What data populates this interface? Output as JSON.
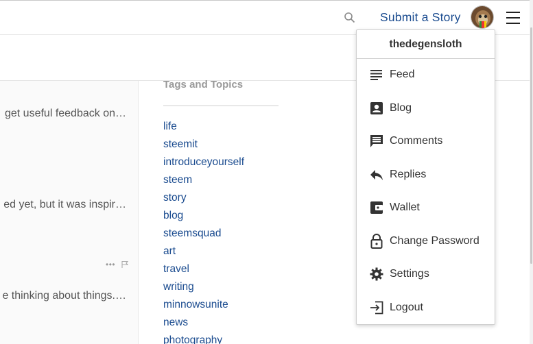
{
  "header": {
    "submit_label": "Submit a Story",
    "search_icon": "search-icon",
    "menu_icon": "hamburger-icon"
  },
  "feed": {
    "snippets": [
      "get useful feedback on…",
      "ed yet, but it was inspir…",
      "e thinking about things.…"
    ],
    "more_actions": "•••"
  },
  "tags": {
    "title": "Tags and Topics",
    "items": [
      "life",
      "steemit",
      "introduceyourself",
      "steem",
      "story",
      "blog",
      "steemsquad",
      "art",
      "travel",
      "writing",
      "minnowsunite",
      "news",
      "photography"
    ]
  },
  "user_menu": {
    "username": "thedegensloth",
    "items": [
      {
        "label": "Feed",
        "icon": "feed-list-icon"
      },
      {
        "label": "Blog",
        "icon": "blog-person-icon"
      },
      {
        "label": "Comments",
        "icon": "comments-icon"
      },
      {
        "label": "Replies",
        "icon": "reply-arrow-icon"
      },
      {
        "label": "Wallet",
        "icon": "wallet-icon"
      },
      {
        "label": "Change Password",
        "icon": "lock-icon"
      },
      {
        "label": "Settings",
        "icon": "gear-icon"
      },
      {
        "label": "Logout",
        "icon": "logout-icon"
      }
    ]
  },
  "colors": {
    "link": "#1a4b8f",
    "muted": "#999999",
    "text": "#333333"
  }
}
